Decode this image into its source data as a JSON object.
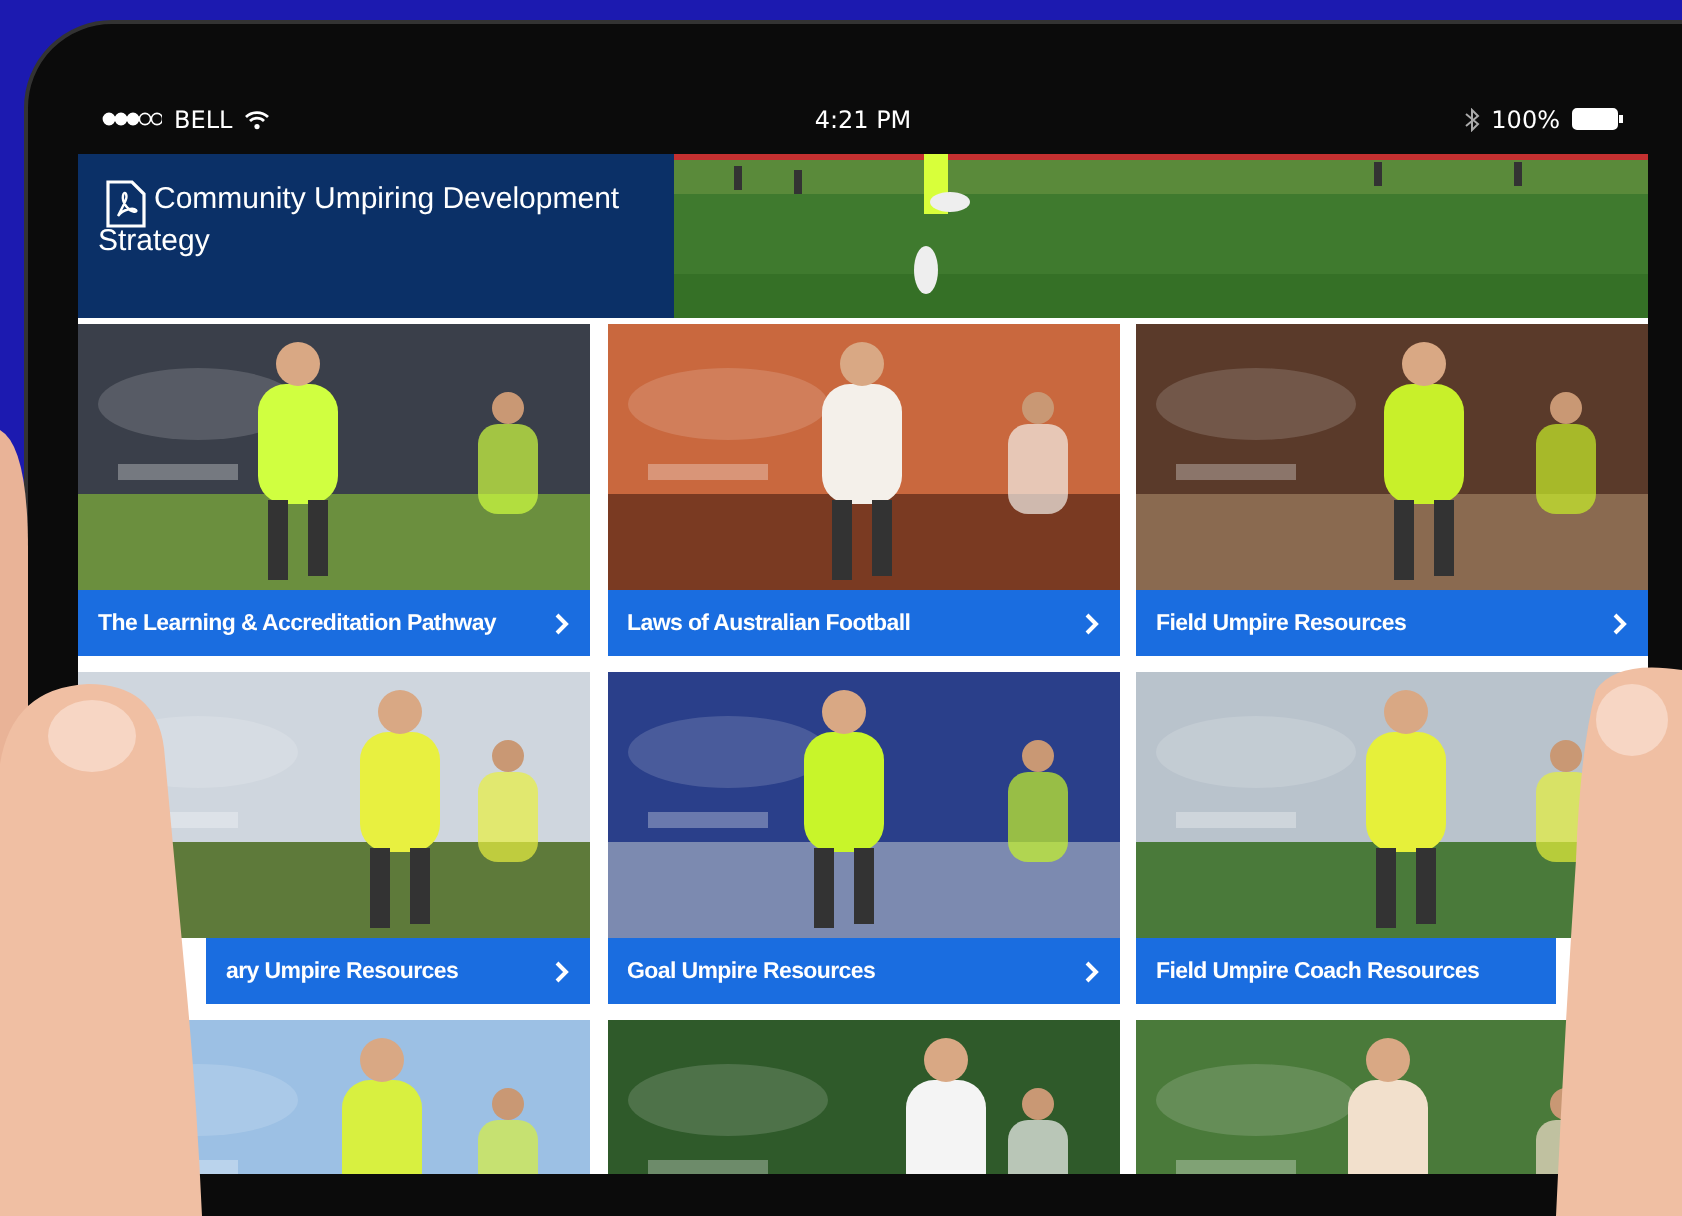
{
  "status_bar": {
    "carrier": "BELL",
    "time": "4:21 PM",
    "battery": "100%"
  },
  "banner": {
    "title": "Community Umpiring Development Strategy"
  },
  "tiles": [
    {
      "kind": "link",
      "label": "The Learning & Accreditation Pathway",
      "chevron": true,
      "covered_left": false,
      "covered_right": false
    },
    {
      "kind": "link",
      "label": "Laws of Australian Football",
      "chevron": true,
      "covered_left": false,
      "covered_right": false
    },
    {
      "kind": "link",
      "label": "Field Umpire Resources",
      "chevron": true,
      "covered_left": false,
      "covered_right": false
    },
    {
      "kind": "link",
      "label": "ary Umpire Resources",
      "chevron": true,
      "covered_left": true,
      "covered_right": false
    },
    {
      "kind": "link",
      "label": "Goal Umpire Resources",
      "chevron": true,
      "covered_left": false,
      "covered_right": false
    },
    {
      "kind": "link",
      "label": "Field Umpire Coach Resources",
      "chevron": false,
      "covered_left": false,
      "covered_right": true
    },
    {
      "kind": "picture"
    },
    {
      "kind": "picture"
    },
    {
      "kind": "picture"
    }
  ]
}
